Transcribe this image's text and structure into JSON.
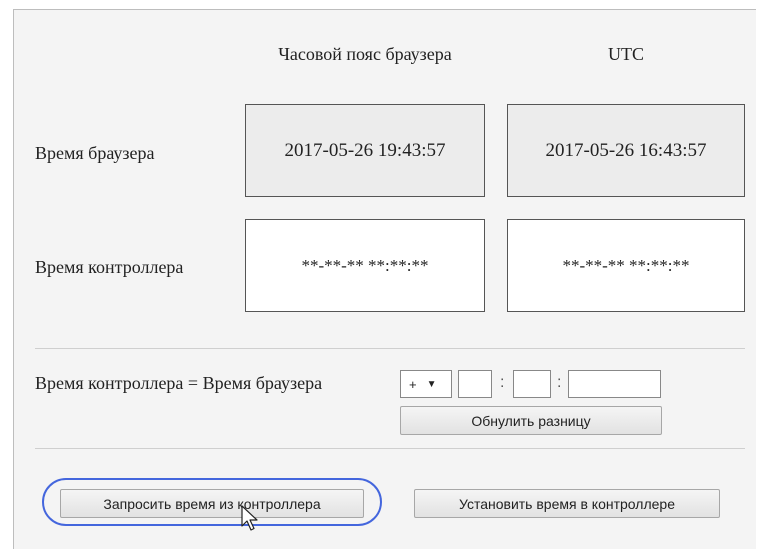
{
  "headers": {
    "browser_tz": "Часовой пояс браузера",
    "utc": "UTC"
  },
  "rows": {
    "browser_time_label": "Время браузера",
    "controller_time_label": "Время контроллера"
  },
  "values": {
    "browser_local": "2017-05-26 19:43:57",
    "browser_utc": "2017-05-26 16:43:57",
    "controller_local": "**-**-** **:**:**",
    "controller_utc": "**-**-** **:**:**"
  },
  "offset": {
    "formula_label": "Время контроллера = Время браузера",
    "sign_selected": "+",
    "hours": "",
    "minutes": "",
    "seconds": "",
    "separator": ":",
    "reset_label": "Обнулить разницу"
  },
  "actions": {
    "request_label": "Запросить время из контроллера",
    "set_label": "Установить время в контроллере"
  },
  "colors": {
    "highlight": "#4466dd",
    "box_shade": "#ececec"
  }
}
